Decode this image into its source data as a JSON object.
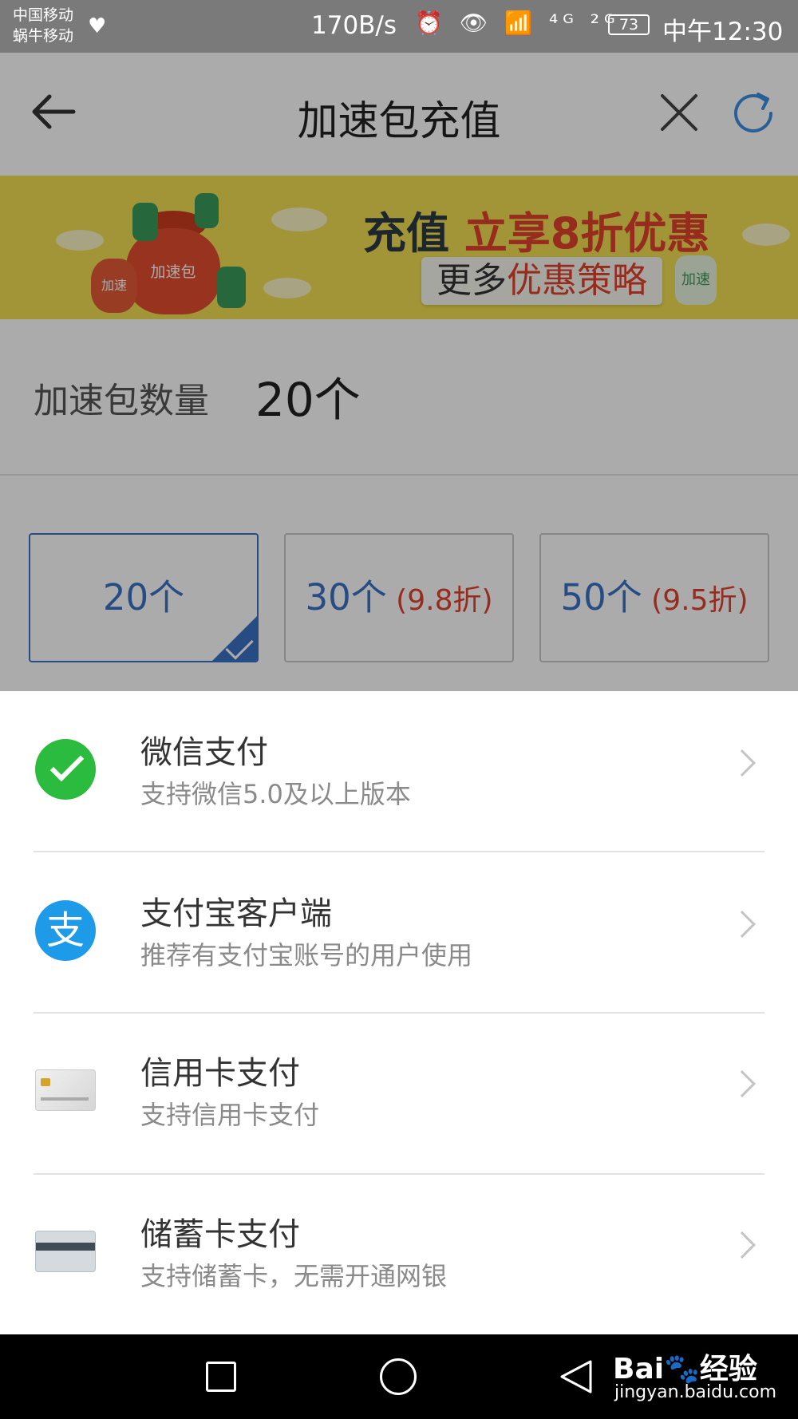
{
  "status_bar": {
    "carrier_1": "中国移动",
    "carrier_2": "蜗牛移动",
    "net_speed": "170B/s",
    "icons_text": "⏰ 👁 📶 ⁴ᴳ ²ᴳ",
    "battery": "73",
    "time": "中午12:30"
  },
  "header": {
    "title": "加速包充值"
  },
  "banner": {
    "headline_prefix": "充值 ",
    "headline_highlight": "立享8折优惠",
    "pill_prefix": "更多",
    "pill_highlight": "优惠策略",
    "bag_label": "加速包",
    "small_bag_label": "加速",
    "bottle_label": "加速"
  },
  "quantity": {
    "label": "加速包数量",
    "value": "20个"
  },
  "options": [
    {
      "count": "20个",
      "discount": "",
      "selected": true
    },
    {
      "count": "30个",
      "discount": " (9.8折)",
      "selected": false
    },
    {
      "count": "50个",
      "discount": " (9.5折)",
      "selected": false
    }
  ],
  "payment_methods": [
    {
      "title": "微信支付",
      "subtitle": "支持微信5.0及以上版本",
      "icon": "wechat-icon"
    },
    {
      "title": "支付宝客户端",
      "subtitle": "推荐有支付宝账号的用户使用",
      "icon": "alipay-icon",
      "glyph": "支"
    },
    {
      "title": "信用卡支付",
      "subtitle": "支持信用卡支付",
      "icon": "credit-card-icon"
    },
    {
      "title": "储蓄卡支付",
      "subtitle": "支持储蓄卡，无需开通网银",
      "icon": "debit-card-icon"
    }
  ],
  "watermark": {
    "brand": "Bai🐾经验",
    "url": "jingyan.baidu.com"
  },
  "colors": {
    "accent_blue": "#3b72c4",
    "discount_red": "#e0402d",
    "banner_yellow": "#f1df52",
    "wechat_green": "#2bbb3e",
    "alipay_blue": "#1e9be8"
  }
}
